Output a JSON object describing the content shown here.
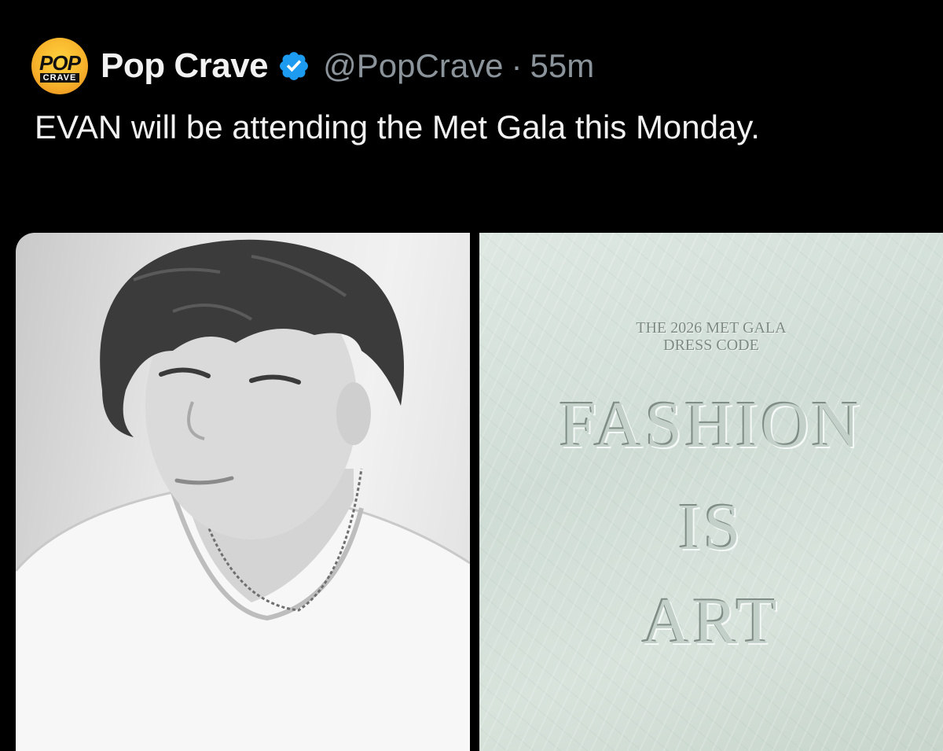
{
  "author": {
    "avatar_icon": "pop-crave-logo-icon",
    "avatar_top": "POP",
    "avatar_bottom": "CRAVE",
    "display_name": "Pop Crave",
    "verified_icon": "verified-badge-icon",
    "verified_color": "#1d9bf0",
    "handle": "@PopCrave",
    "separator": "·",
    "time": "55m"
  },
  "tweet": {
    "text": "EVAN will be attending the Met Gala this Monday."
  },
  "media": [
    {
      "kind": "photo",
      "subject": "black-and-white portrait"
    },
    {
      "kind": "photo",
      "line1": "THE 2026 MET GALA",
      "line2": "DRESS CODE",
      "word1": "FASHION",
      "word2": "IS",
      "word3": "ART"
    }
  ]
}
